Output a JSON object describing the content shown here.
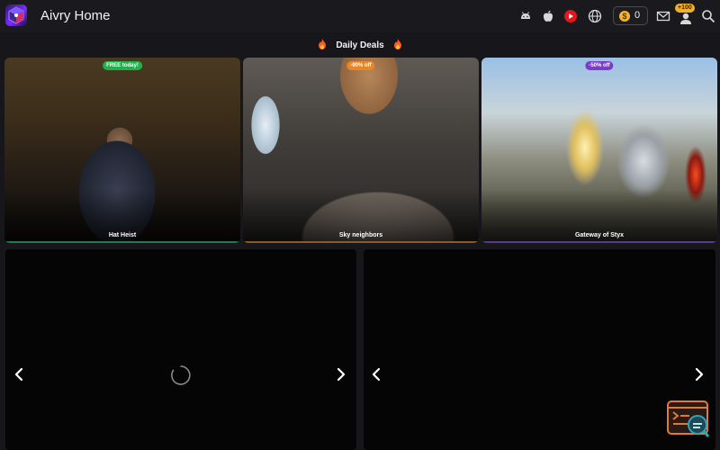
{
  "header": {
    "app_title": "Aivry Home",
    "icons": [
      "android-icon",
      "apple-icon",
      "youtube-icon",
      "globe-icon",
      "mail-icon",
      "user-icon",
      "search-icon"
    ],
    "coins": {
      "count": "0",
      "symbol": "$"
    },
    "profile_badge": "+100"
  },
  "deals": {
    "title": "Daily Deals",
    "cards": [
      {
        "title": "Hat Heist",
        "tag": "FREE today!",
        "tag_color": "#22b04b",
        "glow_color": "#1f7a55"
      },
      {
        "title": "Sky neighbors",
        "tag": "-90% off",
        "tag_color": "#e8872a",
        "glow_color": "#8a5a2a"
      },
      {
        "title": "Gateway of Styx",
        "tag": "-50% off",
        "tag_color": "#7a3cc9",
        "glow_color": "#5a3a8a"
      }
    ]
  },
  "colors": {
    "background": "#17161a",
    "panel": "#050506",
    "accent_coin": "#f3b531",
    "flame": "#ff5a1f"
  }
}
